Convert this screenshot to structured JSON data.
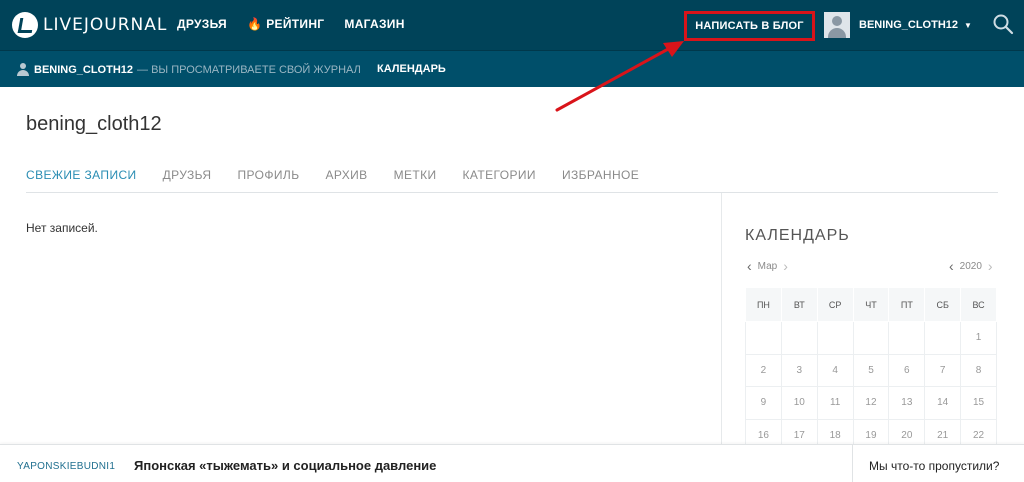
{
  "topbar": {
    "logo_text": "LIVEJOURNAL",
    "nav": [
      "ДРУЗЬЯ",
      "РЕЙТИНГ",
      "МАГАЗИН"
    ],
    "write_button": "НАПИСАТЬ В БЛОГ",
    "username": "BENING_CLOTH12",
    "caret": "▼"
  },
  "subbar": {
    "username": "BENING_CLOTH12",
    "note": "— ВЫ ПРОСМАТРИВАЕТЕ СВОЙ ЖУРНАЛ",
    "calendar_link": "КАЛЕНДАРЬ"
  },
  "journal": {
    "title": "bening_cloth12",
    "tabs": [
      "СВЕЖИЕ ЗАПИСИ",
      "ДРУЗЬЯ",
      "ПРОФИЛЬ",
      "АРХИВ",
      "МЕТКИ",
      "КАТЕГОРИИ",
      "ИЗБРАННОЕ"
    ],
    "empty_text": "Нет записей."
  },
  "calendar": {
    "title": "КАЛЕНДАРЬ",
    "month": "Мар",
    "year": "2020",
    "weekdays": [
      "ПН",
      "ВТ",
      "СР",
      "ЧТ",
      "ПТ",
      "СБ",
      "ВС"
    ],
    "weeks": [
      [
        "",
        "",
        "",
        "",
        "",
        "",
        "1"
      ],
      [
        "2",
        "3",
        "4",
        "5",
        "6",
        "7",
        "8"
      ],
      [
        "9",
        "10",
        "11",
        "12",
        "13",
        "14",
        "15"
      ],
      [
        "16",
        "17",
        "18",
        "19",
        "20",
        "21",
        "22"
      ]
    ]
  },
  "bottom": {
    "user": "YAPONSKIEBUDNI1",
    "text": "Японская «тыжемать» и социальное давление",
    "right": "Мы что-то пропустили?"
  },
  "colors": {
    "topbar": "#004359",
    "subbar": "#004f6a",
    "annotation": "#d9141a",
    "active_tab": "#2a8db3"
  }
}
